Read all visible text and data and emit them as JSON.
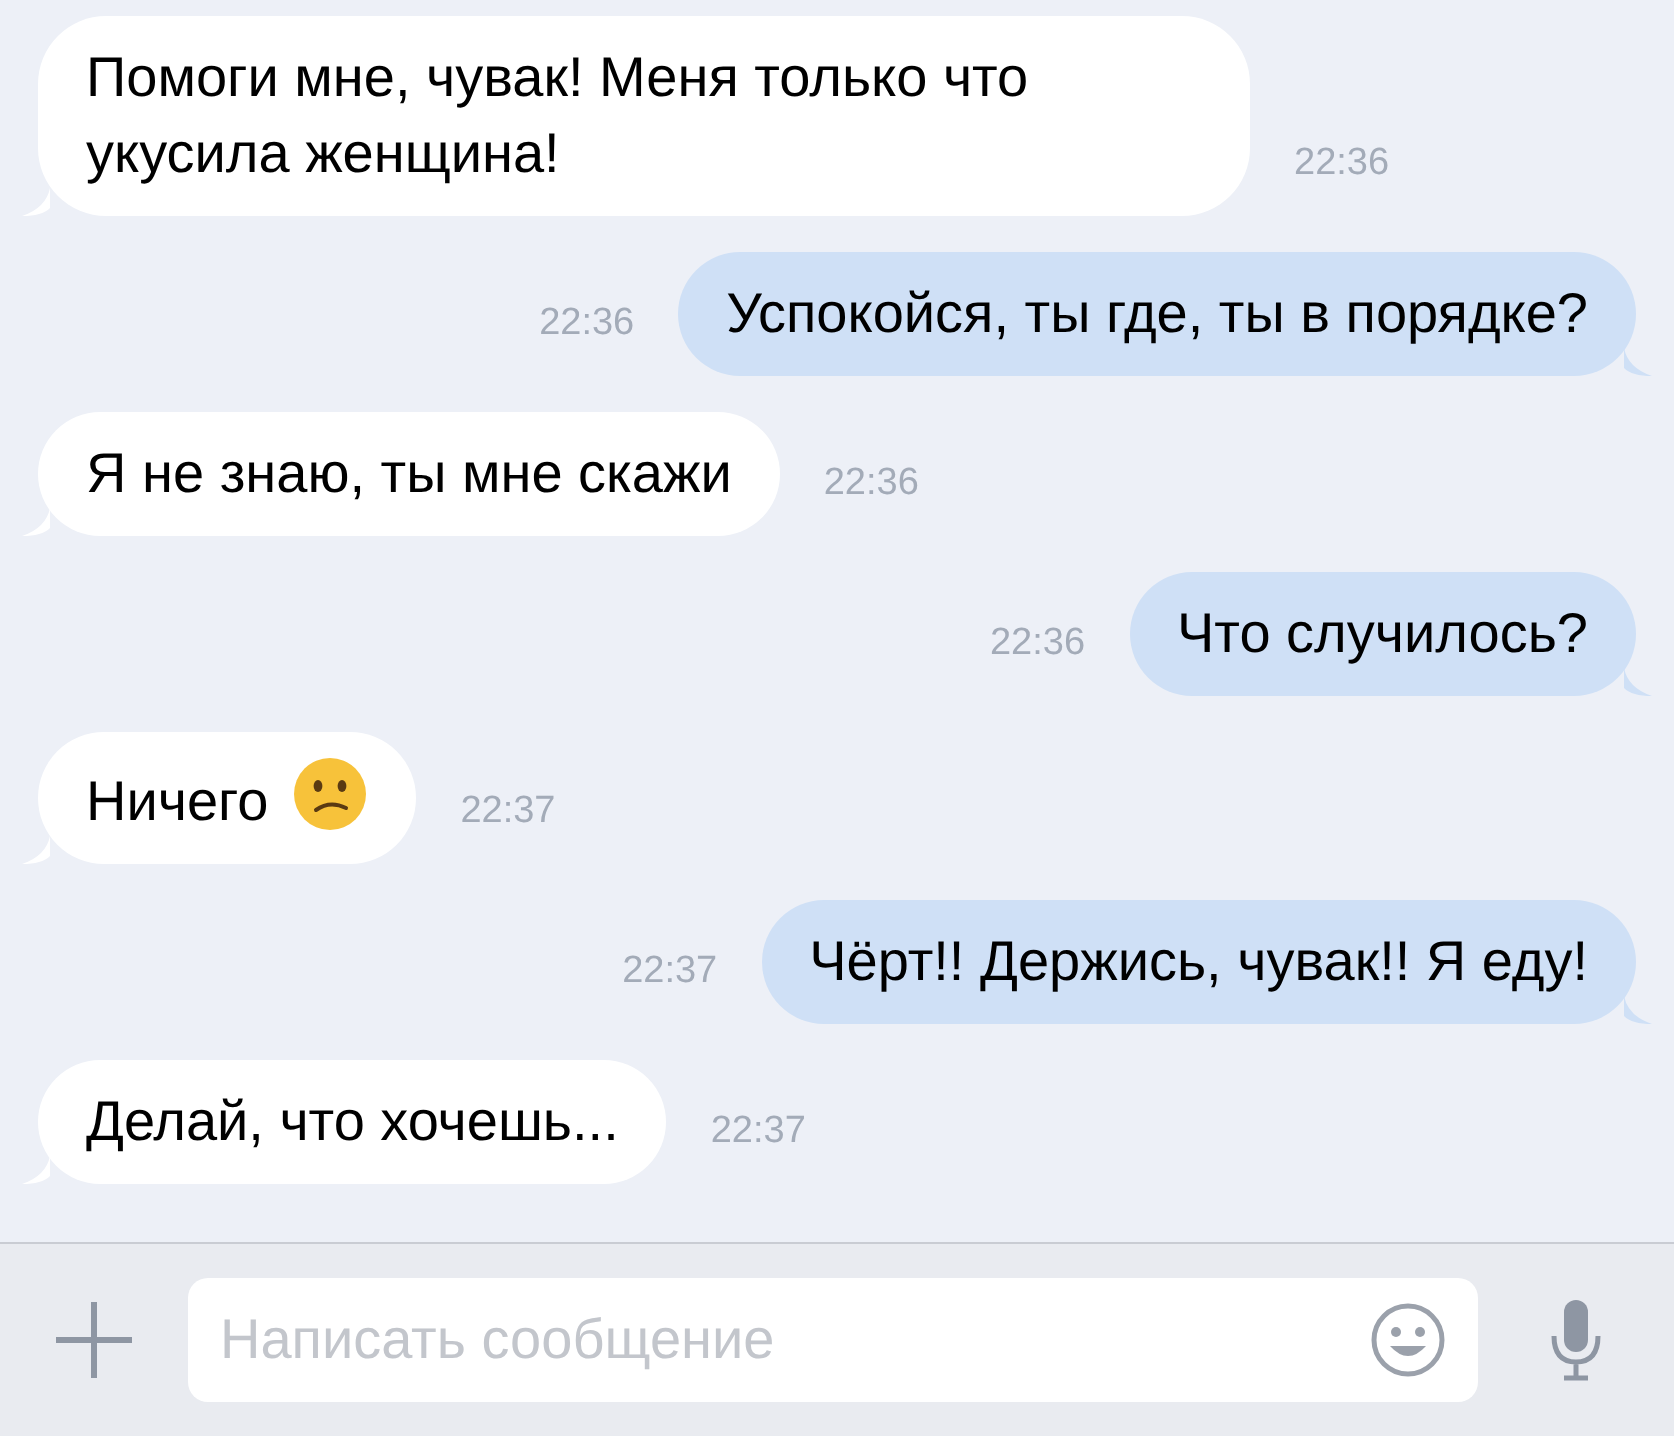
{
  "messages": [
    {
      "outgoing": false,
      "text": "Помоги мне, чувак! Меня только что укусила женщина!",
      "time": "22:36",
      "emoji": false
    },
    {
      "outgoing": true,
      "text": "Успокойся, ты где, ты в порядке?",
      "time": "22:36",
      "emoji": false
    },
    {
      "outgoing": false,
      "text": "Я не знаю, ты мне скажи",
      "time": "22:36",
      "emoji": false
    },
    {
      "outgoing": true,
      "text": "Что случилось?",
      "time": "22:36",
      "emoji": false
    },
    {
      "outgoing": false,
      "text": "Ничего",
      "time": "22:37",
      "emoji": true
    },
    {
      "outgoing": true,
      "text": "Чёрт!! Держись, чувак!! Я еду!",
      "time": "22:37",
      "emoji": false
    },
    {
      "outgoing": false,
      "text": "Делай, что хочешь...",
      "time": "22:37",
      "emoji": false
    }
  ],
  "composer": {
    "placeholder": "Написать сообщение"
  }
}
